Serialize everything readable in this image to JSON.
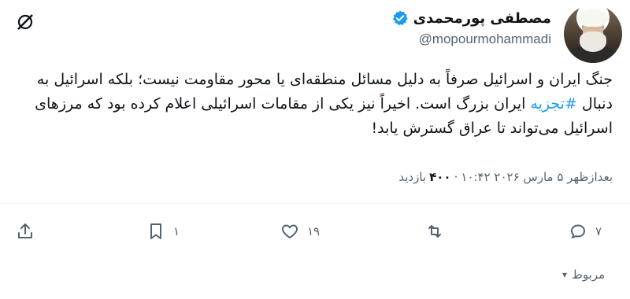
{
  "user": {
    "display_name": "مصطفی پورمحمدی",
    "handle": "@mopourmohammadi"
  },
  "tweet": {
    "text_part1": "جنگ ایران و اسرائیل صرفاً به دلیل مسائل منطقه‌ای یا محور مقاومت نیست؛ بلکه اسرائیل به دنبال ",
    "hashtag": "#تجزیه",
    "text_part2": " ایران بزرگ است. اخیراً نیز یکی از مقامات اسرائیلی اعلام کرده بود که مرزهای اسرائیل می‌تواند تا عراق گسترش یابد!"
  },
  "meta": {
    "timestamp": "بعدازظهر ۵ مارس ۲۰۲۶ ۱۰:۴۲",
    "separator": "·",
    "views_label": "بازدید",
    "views_count": "۴۰۰"
  },
  "actions": {
    "replies": "۷",
    "retweets": "",
    "likes": "۱۹",
    "bookmarks": "۱"
  },
  "related": {
    "label": "مربوط",
    "chevron": "▾"
  },
  "colors": {
    "accent": "#1d9bf0",
    "secondary_text": "#536471",
    "primary_text": "#0f1419"
  }
}
